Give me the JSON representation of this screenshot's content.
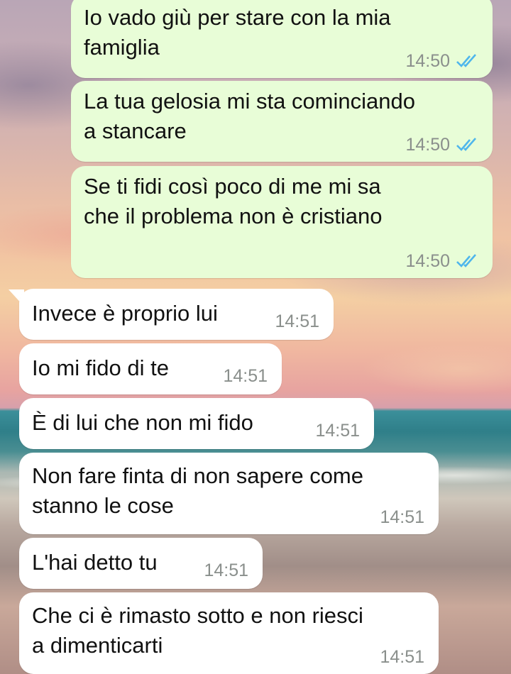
{
  "colors": {
    "outgoing_bubble": "#e8fdd7",
    "incoming_bubble": "#ffffff",
    "timestamp": "#8a8f8c",
    "read_ticks": "#4fb6ec"
  },
  "icons": {
    "read_receipt": "double-check-icon"
  },
  "messages": [
    {
      "direction": "outgoing",
      "text": "Io vado giù per stare con la mia\nfamiglia",
      "time": "14:50",
      "status": "read"
    },
    {
      "direction": "outgoing",
      "text": "La tua gelosia mi sta cominciando\na stancare",
      "time": "14:50",
      "status": "read"
    },
    {
      "direction": "outgoing",
      "text": "Se ti fidi così poco di me mi sa\nche il problema non è cristiano",
      "time": "14:50",
      "status": "read"
    },
    {
      "direction": "incoming",
      "text": "Invece è proprio lui",
      "time": "14:51"
    },
    {
      "direction": "incoming",
      "text": "Io mi fido di te",
      "time": "14:51"
    },
    {
      "direction": "incoming",
      "text": "È di lui che non mi fido",
      "time": "14:51"
    },
    {
      "direction": "incoming",
      "text": "Non fare finta di non sapere come\nstanno le cose",
      "time": "14:51"
    },
    {
      "direction": "incoming",
      "text": "L'hai detto tu",
      "time": "14:51"
    },
    {
      "direction": "incoming",
      "text": "Che ci è rimasto sotto e non riesci\na dimenticarti",
      "time": "14:51"
    }
  ]
}
